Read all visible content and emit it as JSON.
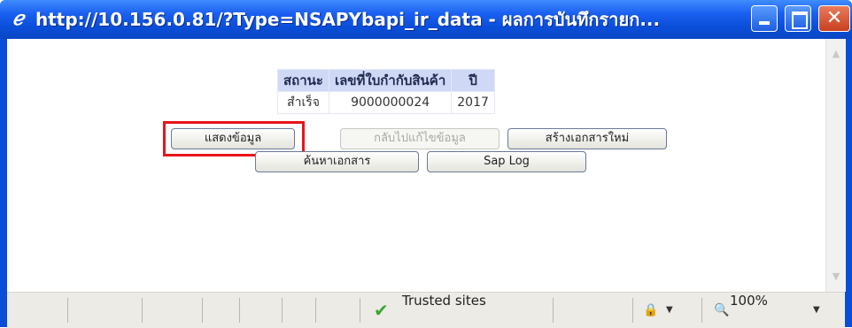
{
  "window": {
    "title": "http://10.156.0.81/?Type=NSAPYbapi_ir_data - ผลการบันทึกรายก...",
    "minimize_icon": "minimize-icon",
    "maximize_icon": "maximize-icon",
    "close_icon": "close-icon"
  },
  "result_table": {
    "headers": [
      "สถานะ",
      "เลขที่ใบกำกับสินค้า",
      "ปี"
    ],
    "row": [
      "สำเร็จ",
      "9000000024",
      "2017"
    ]
  },
  "buttons": {
    "show_data": "แสดงข้อมูล",
    "back_edit": "กลับไปแก้ไขข้อมูล",
    "create_new": "สร้างเอกสารใหม่",
    "search_doc": "ค้นหาเอกสาร",
    "sap_log": "Sap Log"
  },
  "highlight_color": "#e8141a",
  "statusbar": {
    "zone": "Trusted sites",
    "zoom": "100%"
  }
}
